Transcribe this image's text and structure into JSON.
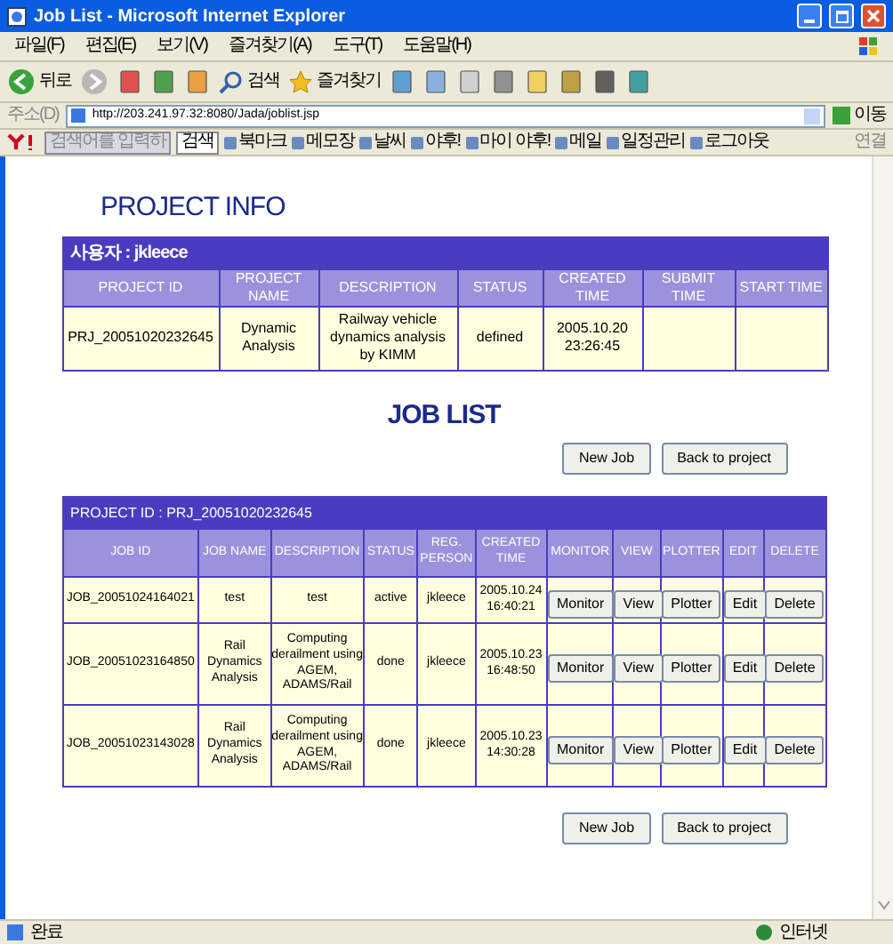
{
  "window": {
    "title": "Job List - Microsoft Internet Explorer"
  },
  "menu": [
    "파일(F)",
    "편집(E)",
    "보기(V)",
    "즐겨찾기(A)",
    "도구(T)",
    "도움말(H)"
  ],
  "toolbar": {
    "back": "뒤로",
    "search": "검색",
    "favorites": "즐겨찾기"
  },
  "address": {
    "label": "주소(D)",
    "url": "http://203.241.97.32:8080/Jada/joblist.jsp",
    "go": "이동"
  },
  "links_bar": {
    "search_placeholder": "검색어를 입력하",
    "search_button": "검색",
    "items": [
      "북마크",
      "메모장",
      "날씨",
      "야후!",
      "마이 야후!",
      "메일",
      "일정관리",
      "로그아웃"
    ],
    "right": "연결"
  },
  "project_info": {
    "title": "PROJECT INFO",
    "user": "사용자 : jkleece",
    "columns": [
      "PROJECT ID",
      "PROJECT NAME",
      "DESCRIPTION",
      "STATUS",
      "CREATED TIME",
      "SUBMIT TIME",
      "START TIME"
    ],
    "row": [
      "PRJ_20051020232645",
      "Dynamic Analysis",
      "Railway vehicle dynamics analysis by KIMM",
      "defined",
      "2005.10.20 23:26:45"
    ]
  },
  "job_list": {
    "title": "JOB LIST",
    "buttons": [
      "New Job",
      "Back to project"
    ],
    "project_id": "PROJECT ID : PRJ_20051020232645",
    "columns": [
      "JOB ID",
      "JOB NAME",
      "DESCRIPTION",
      "STATUS",
      "REG. PERSON",
      "CREATED TIME",
      "MONITOR",
      "VIEW",
      "PLOTTER",
      "EDIT",
      "DELETE"
    ],
    "rows": [
      {
        "cells": [
          "JOB_20051024164021",
          "test",
          "test",
          "active",
          "jkleece",
          "2005.10.24 16:40:21"
        ],
        "actions": [
          "Monitor",
          "View",
          "Plotter",
          "Edit",
          "Delete"
        ]
      },
      {
        "cells": [
          "JOB_20051023164850",
          "Rail Dynamics Analysis",
          "Computing derailment using AGEM, ADAMS/Rail",
          "done",
          "jkleece",
          "2005.10.23 16:48:50"
        ],
        "actions": [
          "Monitor",
          "View",
          "Plotter",
          "Edit",
          "Delete"
        ]
      },
      {
        "cells": [
          "JOB_20051023143028",
          "Rail Dynamics Analysis",
          "Computing derailment using AGEM, ADAMS/Rail",
          "done",
          "jkleece",
          "2005.10.23 14:30:28"
        ],
        "actions": [
          "Monitor",
          "View",
          "Plotter",
          "Edit",
          "Delete"
        ]
      }
    ],
    "bottom_buttons": [
      "New Job",
      "Back to project"
    ]
  },
  "status_bar": {
    "left": "완료",
    "zone": "인터넷"
  }
}
